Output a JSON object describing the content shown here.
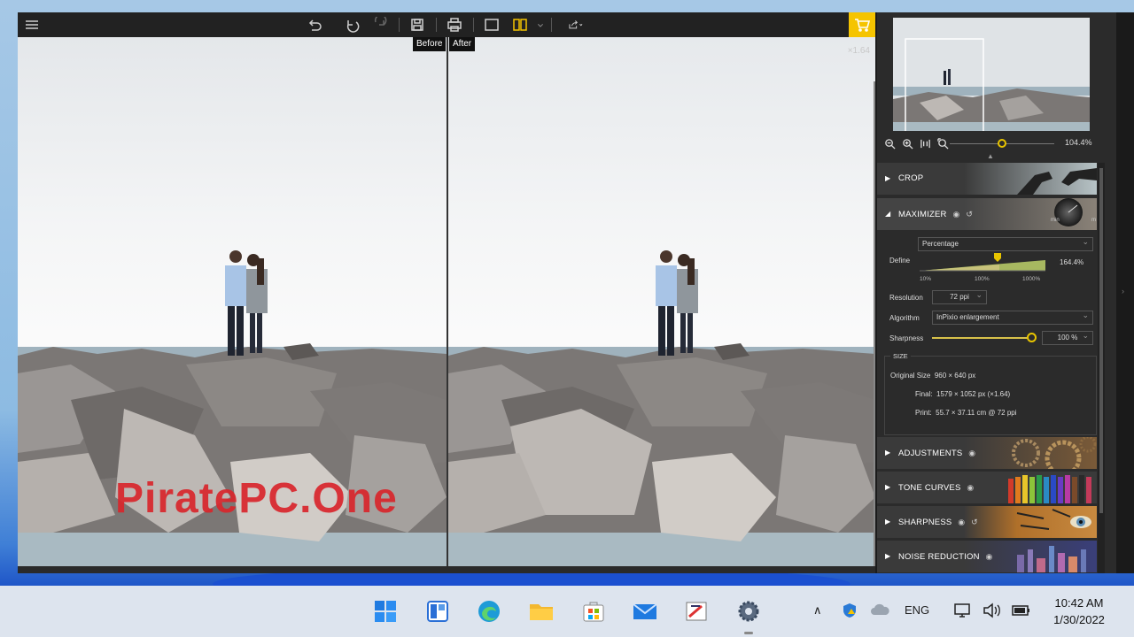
{
  "app": {
    "toolbar_icons": [
      "menu-icon",
      "undo-all-icon",
      "undo-icon",
      "redo-icon",
      "save-icon",
      "print-icon",
      "single-view-icon",
      "split-view-icon",
      "share-icon",
      "cart-icon"
    ],
    "before_label": "Before",
    "after_label": "After",
    "zoom_factor": "×1.64",
    "watermark": "PiratePC.One"
  },
  "navigator": {
    "zoom_value": "104.4%",
    "zoom_fraction": 0.55
  },
  "sections": {
    "crop": "CROP",
    "maximizer": "MAXIMIZER",
    "adjustments": "ADJUSTMENTS",
    "tone_curves": "TONE CURVES",
    "sharpness": "SHARPNESS",
    "noise_reduction": "NOISE REDUCTION"
  },
  "maximizer": {
    "knob_min": "min",
    "knob_max": "m",
    "mode": "Percentage",
    "define_label": "Define",
    "define_value": "164.4%",
    "ticks": [
      "10%",
      "100%",
      "1000%"
    ],
    "resolution_label": "Resolution",
    "resolution_value": "72 ppi",
    "algorithm_label": "Algorithm",
    "algorithm_value": "InPixio enlargement",
    "sharpness_label": "Sharpness",
    "sharpness_value": "100 %",
    "sharpness_fraction": 1.0
  },
  "size": {
    "title": "SIZE",
    "original_label": "Original Size",
    "original_value": "960 × 640 px",
    "final_label": "Final:",
    "final_value": "1579 × 1052 px (×1.64)",
    "print_label": "Print:",
    "print_value": "55.7 × 37.11 cm @ 72 ppi"
  },
  "taskbar": {
    "apps": [
      "windows-start-icon",
      "widgets-icon",
      "edge-icon",
      "file-explorer-icon",
      "microsoft-store-icon",
      "mail-icon",
      "paint-icon",
      "settings-icon"
    ],
    "language": "ENG",
    "time": "10:42 AM",
    "date": "1/30/2022"
  },
  "colors": {
    "accent": "#f5c400",
    "panel_bg": "#2b2b2b",
    "toolbar_bg": "#222222",
    "watermark": "#d9262c"
  }
}
